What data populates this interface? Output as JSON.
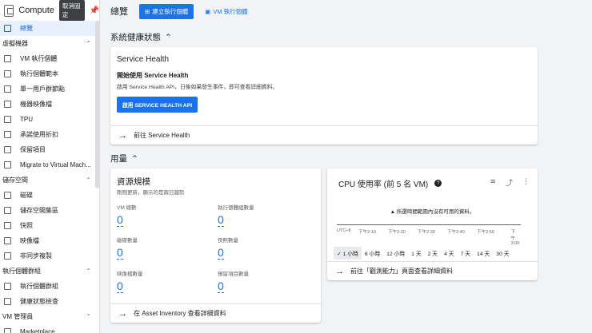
{
  "sidebar": {
    "title": "Compute",
    "unpin_label": "取消固定",
    "items": [
      {
        "type": "item",
        "label": "總覽",
        "icon": "overview-icon",
        "active": true
      },
      {
        "type": "section",
        "label": "虛擬機器"
      },
      {
        "type": "item",
        "label": "VM 執行個體",
        "icon": "vm-icon"
      },
      {
        "type": "item",
        "label": "執行個體範本",
        "icon": "template-icon"
      },
      {
        "type": "item",
        "label": "單一用戶群節點",
        "icon": "sole-tenant-icon"
      },
      {
        "type": "item",
        "label": "機器映像檔",
        "icon": "machine-image-icon"
      },
      {
        "type": "item",
        "label": "TPU",
        "icon": "tpu-icon"
      },
      {
        "type": "item",
        "label": "承諾使用折扣",
        "icon": "discount-icon"
      },
      {
        "type": "item",
        "label": "保留項目",
        "icon": "reservation-icon"
      },
      {
        "type": "item",
        "label": "Migrate to Virtual Mach...",
        "icon": "migrate-icon"
      },
      {
        "type": "section",
        "label": "儲存空間"
      },
      {
        "type": "item",
        "label": "磁碟",
        "icon": "disk-icon"
      },
      {
        "type": "item",
        "label": "儲存空間集區",
        "icon": "storage-pool-icon"
      },
      {
        "type": "item",
        "label": "快照",
        "icon": "snapshot-icon"
      },
      {
        "type": "item",
        "label": "映像檔",
        "icon": "image-icon"
      },
      {
        "type": "item",
        "label": "非同步複製",
        "icon": "async-replication-icon"
      },
      {
        "type": "section",
        "label": "執行個體群組"
      },
      {
        "type": "item",
        "label": "執行個體群組",
        "icon": "instance-group-icon"
      },
      {
        "type": "item",
        "label": "健康狀態檢查",
        "icon": "health-check-icon"
      },
      {
        "type": "section",
        "label": "VM 管理員"
      },
      {
        "type": "item",
        "label": "Marketplace",
        "icon": "marketplace-icon"
      }
    ]
  },
  "header": {
    "title": "總覽",
    "create_button": "建立執行個體",
    "vm_link": "VM 執行個體"
  },
  "system_health": {
    "section_title": "系統健康狀態",
    "card_title": "Service Health",
    "subtitle": "開始使用 Service Health",
    "description": "啟用 Service Health API，日後如果發生事件，即可查看詳細資料。",
    "enable_button": "啟用 SERVICE HEALTH API",
    "link": "前往 Service Health"
  },
  "usage": {
    "section_title": "用量"
  },
  "resources": {
    "title": "資源規模",
    "subtitle": "剛剛更新，顯示的是兩日趨勢",
    "metrics": [
      {
        "label": "VM 總數",
        "value": "0"
      },
      {
        "label": "執行個體組數量",
        "value": "0"
      },
      {
        "label": "磁碟數量",
        "value": "0"
      },
      {
        "label": "快照數量",
        "value": "0"
      },
      {
        "label": "映像檔數量",
        "value": "0"
      },
      {
        "label": "預留項目數量",
        "value": "0"
      }
    ],
    "link": "在 Asset Inventory 查看詳細資料"
  },
  "cpu": {
    "title": "CPU 使用率 (前 5 名 VM)",
    "no_data": "所選時間範圍內沒有可用的資料。",
    "timezone": "UTC+8",
    "ticks": [
      "下午2:10",
      "下午2:20",
      "下午2:30",
      "下午2:40",
      "下午2:50",
      "下午3:00"
    ],
    "ranges": [
      "1 小時",
      "6 小時",
      "12 小時",
      "1 天",
      "2 天",
      "4 天",
      "7 天",
      "14 天",
      "30 天"
    ],
    "selected_range": "1 小時",
    "link": "前往「觀測能力」頁面查看詳細資料"
  }
}
